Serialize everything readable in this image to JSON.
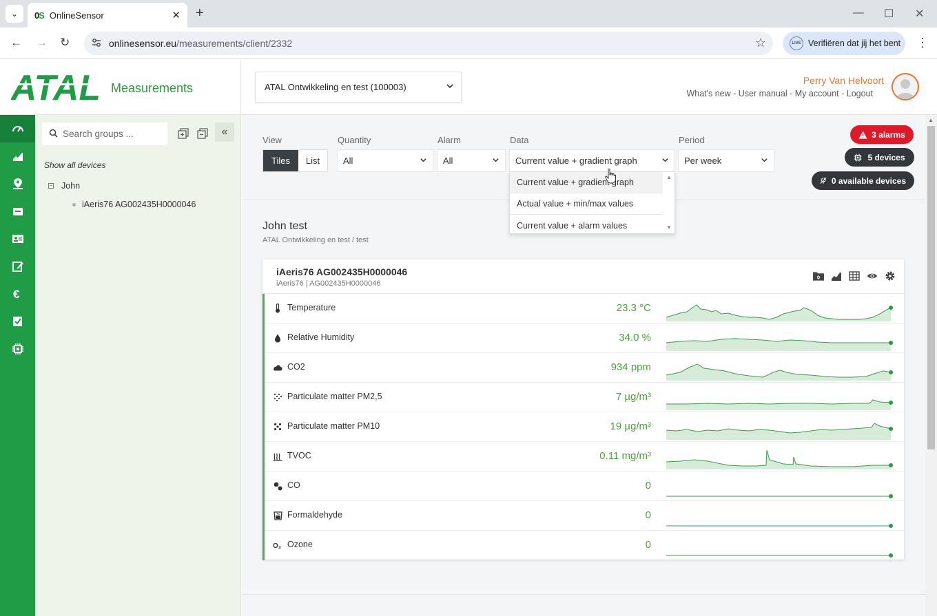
{
  "browser": {
    "tab_title": "OnlineSensor",
    "favicon_text_o": "0",
    "favicon_text_s": "S",
    "url_host": "onlinesensor.eu",
    "url_path": "/measurements/client/2332",
    "verify_label": "Verifiëren dat jij het bent",
    "live_badge": "LIVE"
  },
  "header": {
    "logo_text": "ATAL",
    "app_title": "Measurements",
    "client_select": "ATAL Ontwikkeling en test (100003)",
    "user_name": "Perry Van Helvoort",
    "user_links": "What's new - User manual - My account - Logout"
  },
  "iconbar": {
    "items": [
      "dashboard-icon",
      "chart-icon",
      "map-pin-icon",
      "inbox-icon",
      "contact-card-icon",
      "edit-icon",
      "euro-icon",
      "checklist-icon",
      "chip-icon"
    ]
  },
  "groups": {
    "search_placeholder": "Search groups ...",
    "show_all": "Show all devices",
    "tree": {
      "group": "John",
      "device": "iAeris76 AG002435H0000046"
    }
  },
  "filters": {
    "view_label": "View",
    "view_tiles": "Tiles",
    "view_list": "List",
    "quantity_label": "Quantity",
    "quantity_value": "All",
    "alarm_label": "Alarm",
    "alarm_value": "All",
    "data_label": "Data",
    "data_value": "Current value + gradient graph",
    "period_label": "Period",
    "period_value": "Per week",
    "data_options": [
      "Current value + gradient graph",
      "Actual value + min/max values",
      "Current value + alarm values"
    ]
  },
  "badges": {
    "alarms": "3 alarms",
    "devices": "5 devices",
    "available": "0 available devices"
  },
  "group": {
    "title": "John test",
    "subtitle": "ATAL Ontwikkeling en test / test"
  },
  "device": {
    "title": "iAeris76 AG002435H0000046",
    "subtitle": "iAeris76 | AG002435H0000046",
    "folder_count": "0",
    "measurements": [
      {
        "name": "Temperature",
        "value": "23.3 °C",
        "icon": "thermometer-icon"
      },
      {
        "name": "Relative Humidity",
        "value": "34.0 %",
        "icon": "droplet-icon"
      },
      {
        "name": "CO2",
        "value": "934 ppm",
        "icon": "cloud-icon"
      },
      {
        "name": "Particulate matter PM2,5",
        "value": "7 µg/m³",
        "icon": "particles-small-icon"
      },
      {
        "name": "Particulate matter PM10",
        "value": "19 µg/m³",
        "icon": "particles-large-icon"
      },
      {
        "name": "TVOC",
        "value": "0.11 mg/m³",
        "icon": "vapor-icon"
      },
      {
        "name": "CO",
        "value": "0",
        "icon": "molecule-icon"
      },
      {
        "name": "Formaldehyde",
        "value": "0",
        "icon": "beaker-icon"
      },
      {
        "name": "Ozone",
        "value": "0",
        "icon": "ozone-icon"
      }
    ]
  },
  "colors": {
    "brand_green": "#1f9c45",
    "value_green": "#4aa23a",
    "user_orange": "#e8762d",
    "alarm_red": "#e0192a"
  }
}
